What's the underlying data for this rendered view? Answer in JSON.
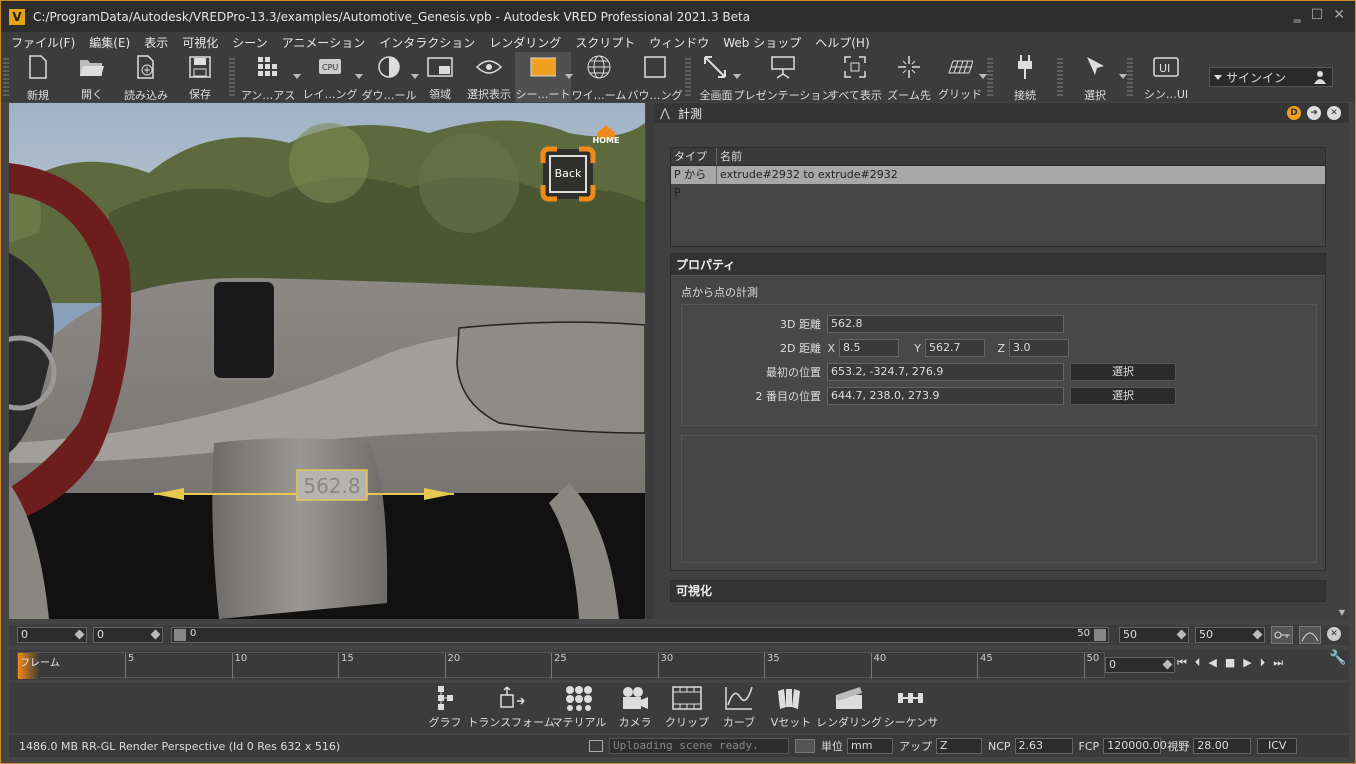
{
  "window": {
    "title": "C:/ProgramData/Autodesk/VREDPro-13.3/examples/Automotive_Genesis.vpb - Autodesk VRED Professional 2021.3 Beta",
    "app_icon": "V",
    "controls": [
      "‗",
      "☐",
      "✕"
    ]
  },
  "menu": [
    "ファイル(F)",
    "編集(E)",
    "表示",
    "可視化",
    "シーン",
    "アニメーション",
    "インタラクション",
    "レンダリング",
    "スクリプト",
    "ウィンドウ",
    "Web ショップ",
    "ヘルプ(H)"
  ],
  "toolbar": [
    {
      "label": "新規",
      "icon": "new-file-icon"
    },
    {
      "label": "開く",
      "icon": "open-folder-icon"
    },
    {
      "label": "読み込み",
      "icon": "import-icon"
    },
    {
      "label": "保存",
      "icon": "save-icon"
    },
    {
      "label": "アン…アス",
      "icon": "antialias-icon"
    },
    {
      "label": "レイ…ング",
      "icon": "raytracing-cpu-icon"
    },
    {
      "label": "ダウ…ール",
      "icon": "downscale-icon"
    },
    {
      "label": "領域",
      "icon": "region-icon"
    },
    {
      "label": "選択表示",
      "icon": "eye-icon"
    },
    {
      "label": "シー…ート",
      "icon": "scene-plate-icon"
    },
    {
      "label": "ワイ…ーム",
      "icon": "wireframe-globe-icon"
    },
    {
      "label": "バウ…ング",
      "icon": "bounding-box-icon"
    },
    {
      "label": "全画面",
      "icon": "fullscreen-icon"
    },
    {
      "label": "プレゼンテーション",
      "icon": "presentation-icon"
    },
    {
      "label": "すべて表示",
      "icon": "view-all-icon"
    },
    {
      "label": "ズーム先",
      "icon": "zoom-to-icon"
    },
    {
      "label": "グリッド",
      "icon": "grid-icon"
    },
    {
      "label": "接続",
      "icon": "plug-icon"
    },
    {
      "label": "選択",
      "icon": "select-icon"
    },
    {
      "label": "シン…UI",
      "icon": "ui-icon"
    }
  ],
  "signin": {
    "label": "サインイン"
  },
  "viewport": {
    "back_label": "Back",
    "home_label": "HOME",
    "measure_value": "562.8"
  },
  "panel": {
    "title": "計測",
    "table": {
      "headers": [
        "タイプ",
        "名前"
      ],
      "rows": [
        [
          "P から P",
          "extrude#2932  to  extrude#2932"
        ]
      ]
    },
    "properties_title": "プロパティ",
    "sub_title": "点から点の計測",
    "dist3d_label": "3D 距離",
    "dist3d_value": "562.8",
    "dist2d_label": "2D 距離",
    "x_label": "X",
    "x_value": "8.5",
    "y_label": "Y",
    "y_value": "562.7",
    "z_label": "Z",
    "z_value": "3.0",
    "first_label": "最初の位置",
    "first_value": "653.2, -324.7, 276.9",
    "second_label": "2 番目の位置",
    "second_value": "644.7, 238.0, 273.9",
    "select_label": "選択",
    "visual_title": "可視化"
  },
  "timeline": {
    "start1": "0",
    "start2": "0",
    "slider_start": "0",
    "slider_end": "50",
    "end1": "50",
    "end2": "50",
    "frame_label": "フレーム",
    "ticks": [
      "5",
      "10",
      "15",
      "20",
      "25",
      "30",
      "35",
      "40",
      "45",
      "50"
    ],
    "current": "0"
  },
  "bottom_tools": [
    {
      "label": "グラフ",
      "icon": "graph-icon"
    },
    {
      "label": "トランスフォーム",
      "icon": "transform-icon"
    },
    {
      "label": "マテリアル",
      "icon": "material-icon"
    },
    {
      "label": "カメラ",
      "icon": "camera-icon"
    },
    {
      "label": "クリップ",
      "icon": "clip-icon"
    },
    {
      "label": "カーブ",
      "icon": "curve-icon"
    },
    {
      "label": "Vセット",
      "icon": "vset-icon"
    },
    {
      "label": "レンダリング",
      "icon": "render-icon"
    },
    {
      "label": "シーケンサ",
      "icon": "sequencer-icon"
    }
  ],
  "status": {
    "memory": "1486.0 MB  RR-GL  Render Perspective (Id 0 Res 632 x 516)",
    "message": "Uploading scene ready.",
    "unit_label": "単位",
    "unit_value": "mm",
    "up_label": "アップ",
    "up_value": "Z",
    "ncp_label": "NCP",
    "ncp_value": "2.63",
    "fcp_label": "FCP",
    "fcp_value": "120000.00",
    "fov_label": "視野",
    "fov_value": "28.00",
    "icv_label": "ICV"
  }
}
